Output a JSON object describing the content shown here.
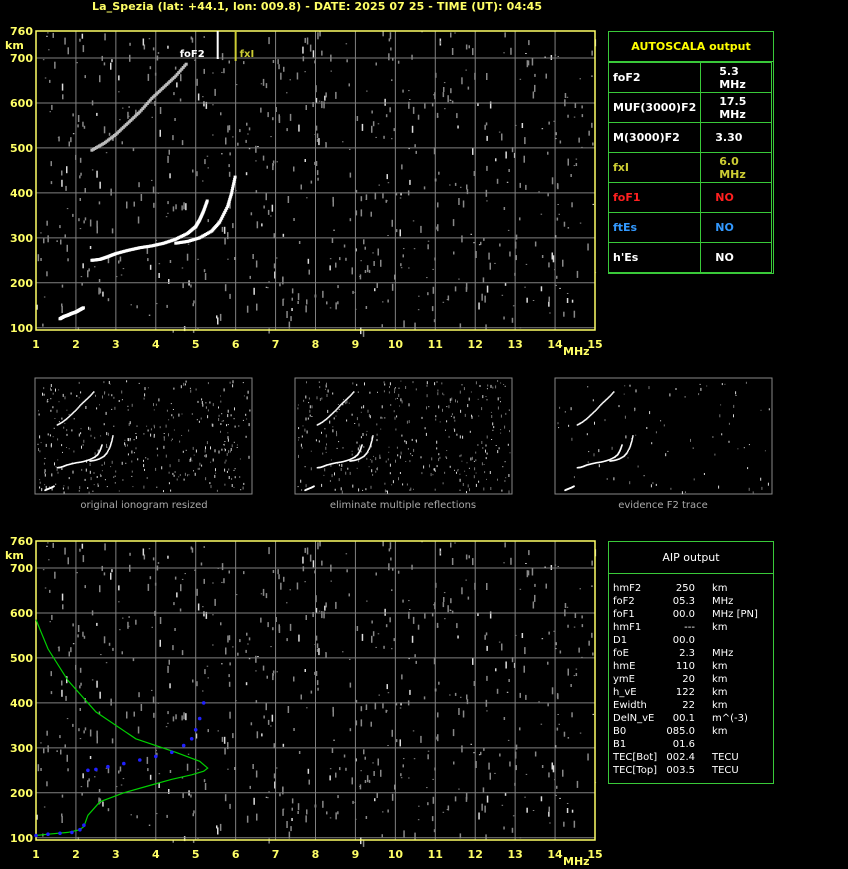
{
  "header": {
    "title": "La_Spezia (lat: +44.1, lon: 009.8) - DATE: 2025 07 25 - TIME (UT): 04:45"
  },
  "colors": {
    "axis": "#ffff66",
    "grid": "#808080",
    "panel_border": "#39c939",
    "table_title": "#ffff00",
    "foF1": "#ff2020",
    "ftEs": "#3399ff",
    "fxI": "#cccc33",
    "profile": "#00d000",
    "trace_fit": "#2020ff"
  },
  "autoscala": {
    "title": "AUTOSCALA output",
    "rows": [
      {
        "label": "foF2",
        "value": "5.3 MHz",
        "color": "#ffffff"
      },
      {
        "label": "MUF(3000)F2",
        "value": "17.5 MHz",
        "color": "#ffffff"
      },
      {
        "label": "M(3000)F2",
        "value": "3.30",
        "color": "#ffffff"
      },
      {
        "label": "fxI",
        "value": "6.0 MHz",
        "color": "#cccc33"
      },
      {
        "label": "foF1",
        "value": "NO",
        "color": "#ff2020"
      },
      {
        "label": "ftEs",
        "value": "NO",
        "color": "#3399ff"
      },
      {
        "label": "h'Es",
        "value": "NO",
        "color": "#ffffff"
      }
    ]
  },
  "aip": {
    "title": "AIP output",
    "rows": [
      [
        "hmF2",
        "250",
        "km"
      ],
      [
        "foF2",
        "05.3",
        "MHz"
      ],
      [
        "foF1",
        "00.0",
        "MHz   [PN]"
      ],
      [
        "hmF1",
        "---",
        "km"
      ],
      [
        "D1",
        "00.0",
        ""
      ],
      [
        "foE",
        "2.3",
        "MHz"
      ],
      [
        "hmE",
        "110",
        "km"
      ],
      [
        "ymE",
        "20",
        "km"
      ],
      [
        "h_vE",
        "122",
        "km"
      ],
      [
        "Ewidth",
        "22",
        "km"
      ],
      [
        "DelN_vE",
        "00.1",
        "m^(-3)"
      ],
      [
        "B0",
        "085.0",
        "km"
      ],
      [
        "B1",
        "01.6",
        ""
      ],
      [
        "TEC[Bot]",
        "002.4",
        "TECU"
      ],
      [
        "TEC[Top]",
        "003.5",
        "TECU"
      ]
    ]
  },
  "thumbnails": {
    "captions": [
      "original ionogram resized",
      "eliminate multiple reflections",
      "evidence F2 trace"
    ]
  },
  "chart_data": [
    {
      "type": "scatter",
      "name": "ionogram-autoscala",
      "ylabel": "km",
      "xlabel": "MHz",
      "xlim": [
        1,
        15
      ],
      "ylim": [
        95,
        760
      ],
      "xticks": [
        1,
        2,
        3,
        4,
        5,
        6,
        7,
        8,
        9,
        10,
        11,
        12,
        13,
        14,
        15
      ],
      "yticks": [
        100,
        200,
        300,
        400,
        500,
        600,
        700,
        760
      ],
      "grid": true,
      "markers": [
        {
          "label": "foF2",
          "x": 5.3
        },
        {
          "label": "fxI",
          "x": 6.0
        }
      ],
      "series": [
        {
          "values_desc": "O-trace F2",
          "x": [
            2.4,
            2.6,
            2.8,
            3.0,
            3.3,
            3.6,
            3.9,
            4.2,
            4.5,
            4.8,
            5.0,
            5.1,
            5.2,
            5.3
          ],
          "y": [
            250,
            252,
            258,
            265,
            272,
            278,
            282,
            288,
            297,
            310,
            325,
            340,
            360,
            385
          ]
        },
        {
          "values_desc": "X-trace F2",
          "x": [
            4.5,
            4.8,
            5.1,
            5.4,
            5.6,
            5.8,
            5.9,
            6.0
          ],
          "y": [
            288,
            292,
            300,
            315,
            335,
            370,
            400,
            440
          ]
        },
        {
          "values_desc": "E trace",
          "x": [
            1.6,
            1.7,
            1.8,
            1.9,
            2.0,
            2.1,
            2.2
          ],
          "y": [
            120,
            125,
            128,
            132,
            135,
            140,
            145
          ]
        },
        {
          "values_desc": "2nd hop F2",
          "x": [
            2.4,
            2.7,
            3.0,
            3.3,
            3.6,
            3.9,
            4.2,
            4.5,
            4.8
          ],
          "y": [
            495,
            510,
            530,
            555,
            580,
            610,
            635,
            660,
            690
          ]
        }
      ]
    },
    {
      "type": "scatter",
      "name": "ionogram-aip",
      "ylabel": "km",
      "xlabel": "MHz",
      "xlim": [
        1,
        15
      ],
      "ylim": [
        95,
        760
      ],
      "xticks": [
        1,
        2,
        3,
        4,
        5,
        6,
        7,
        8,
        9,
        10,
        11,
        12,
        13,
        14,
        15
      ],
      "yticks": [
        100,
        200,
        300,
        400,
        500,
        600,
        700,
        760
      ],
      "grid": true,
      "profile": {
        "x": [
          1.0,
          1.3,
          1.8,
          2.1,
          2.2,
          2.3,
          2.6,
          3.2,
          3.8,
          4.4,
          4.9,
          5.2,
          5.3,
          5.1,
          4.5,
          3.5,
          2.5,
          1.8,
          1.3,
          1.0
        ],
        "y": [
          105,
          108,
          112,
          118,
          125,
          150,
          180,
          200,
          215,
          230,
          240,
          248,
          255,
          270,
          290,
          320,
          380,
          450,
          520,
          585
        ]
      },
      "fit": {
        "x": [
          1.0,
          1.3,
          1.6,
          1.9,
          2.1,
          2.2,
          2.3,
          2.5,
          2.8,
          3.2,
          3.6,
          4.0,
          4.4,
          4.7,
          4.9,
          5.0,
          5.1,
          5.2
        ],
        "y": [
          105,
          108,
          110,
          112,
          118,
          128,
          250,
          252,
          258,
          265,
          273,
          281,
          290,
          305,
          320,
          340,
          365,
          400
        ]
      }
    }
  ]
}
